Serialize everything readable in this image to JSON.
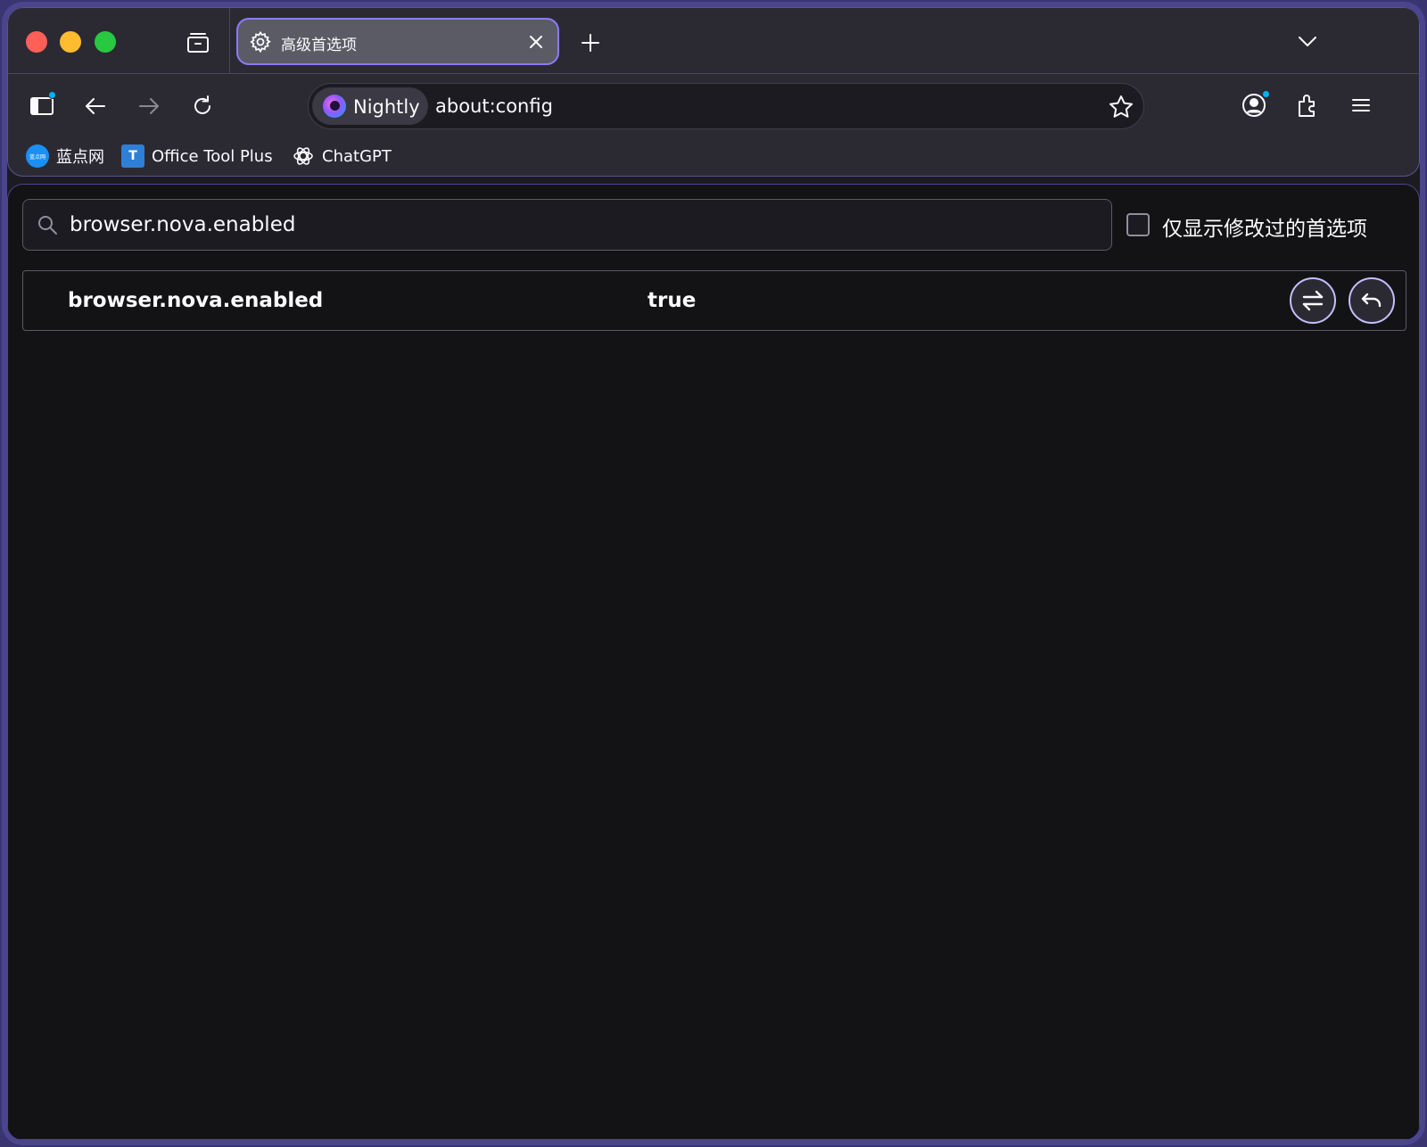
{
  "window": {
    "tab": {
      "title": "高级首选项",
      "icon": "gear-icon"
    },
    "new_tab_label": "+",
    "list_tabs_icon": "chevron-down-icon"
  },
  "navbar": {
    "identity_label": "Nightly",
    "url": "about:config",
    "buttons": [
      "sidebar-toggle-icon",
      "back-arrow-icon",
      "forward-arrow-icon",
      "reload-icon",
      "account-icon",
      "extensions-icon",
      "menu-icon"
    ]
  },
  "bookmarks": [
    {
      "label": "蓝点网",
      "icon": "landian-icon",
      "icon_text": "蓝点网"
    },
    {
      "label": "Office Tool Plus",
      "icon": "office-tool-plus-icon",
      "icon_text": "T"
    },
    {
      "label": "ChatGPT",
      "icon": "chatgpt-icon"
    }
  ],
  "config": {
    "search_value": "browser.nova.enabled",
    "modified_only_label": "仅显示修改过的首选项",
    "modified_only_checked": false,
    "rows": [
      {
        "name": "browser.nova.enabled",
        "value": "true"
      }
    ]
  },
  "colors": {
    "accent": "#8a7bff",
    "frame_border": "#4b4590",
    "toolbar_bg": "#2b2a33",
    "content_bg": "#131316",
    "attention_dot": "#00b3f4"
  }
}
